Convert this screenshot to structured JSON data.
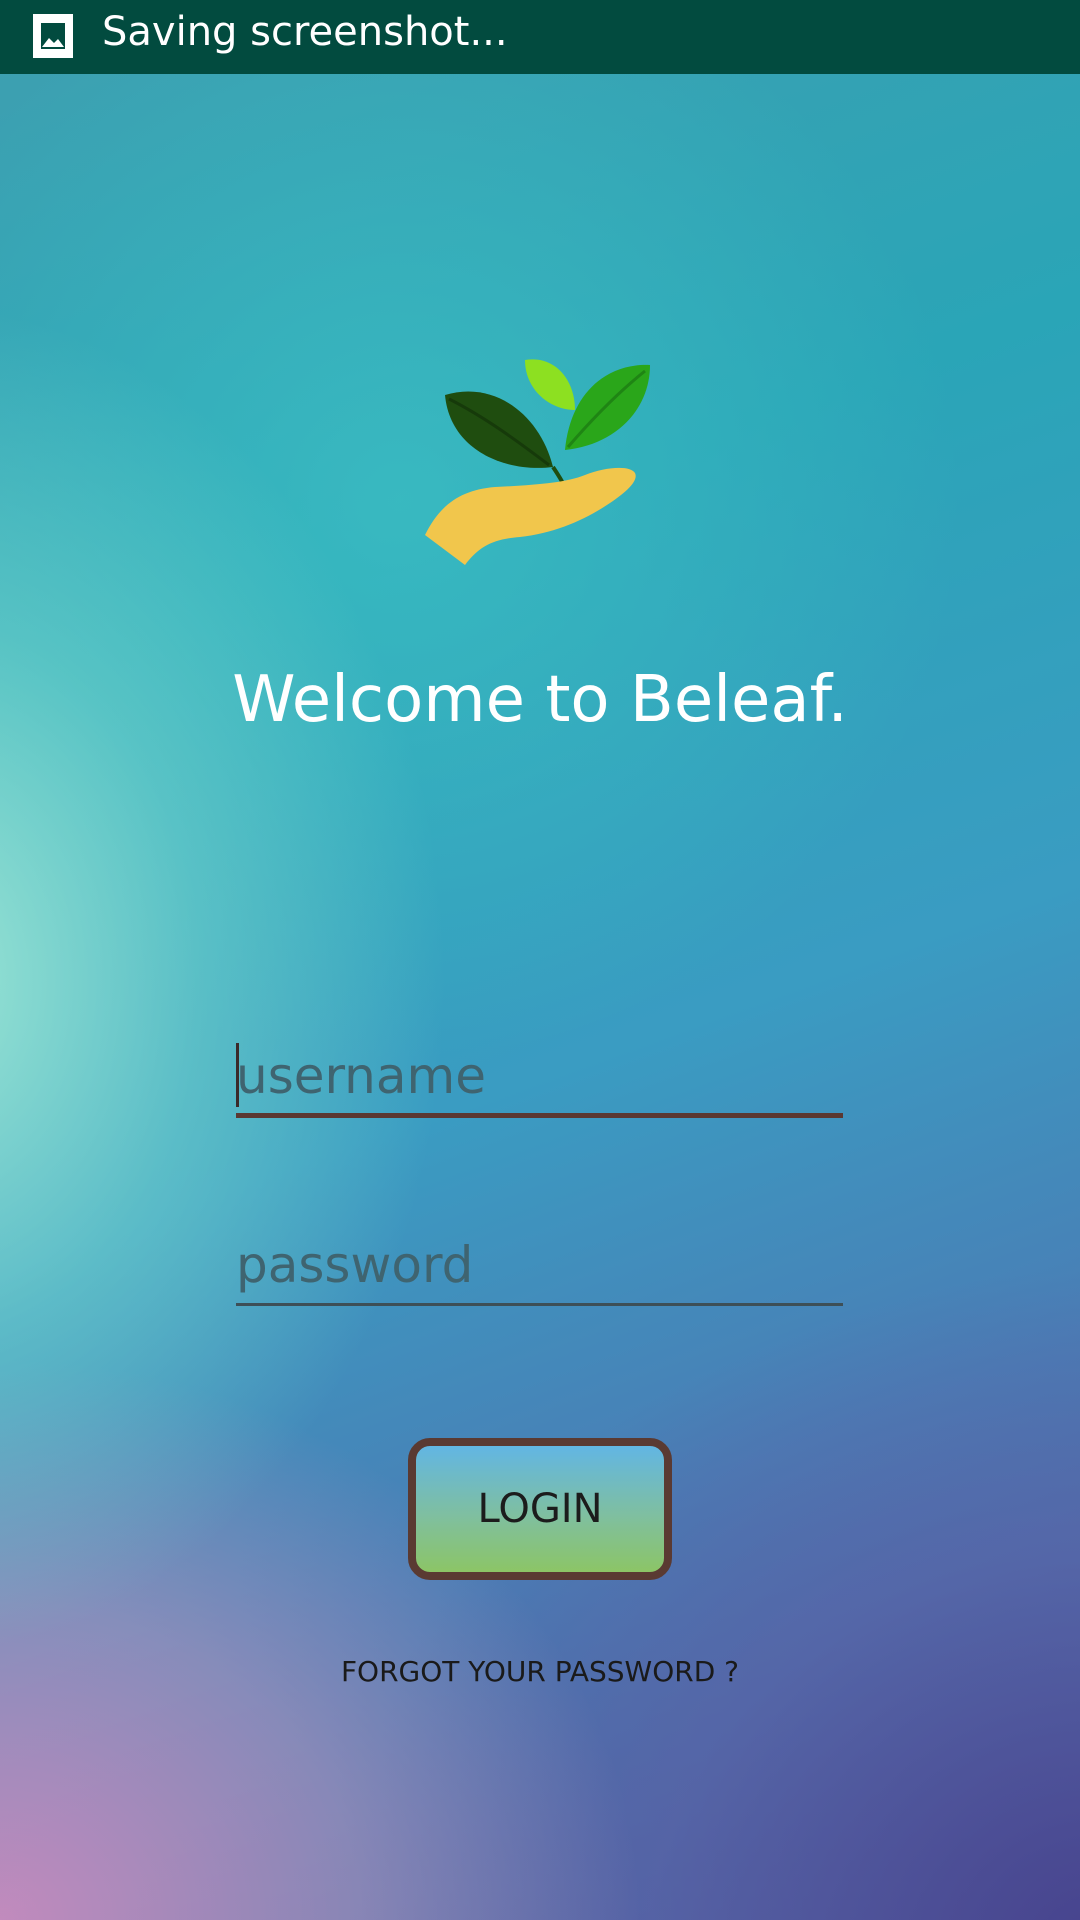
{
  "status_bar": {
    "icon": "image-icon",
    "text": "Saving screenshot..."
  },
  "logo": {
    "icon": "hand-with-leaves-icon"
  },
  "welcome_text": "Welcome to Beleaf.",
  "form": {
    "username": {
      "placeholder": "username",
      "value": ""
    },
    "password": {
      "placeholder": "password",
      "value": ""
    },
    "login_label": "LOGIN",
    "forgot_label": "FORGOT YOUR PASSWORD ?"
  },
  "colors": {
    "status_bar": "#024b3f",
    "login_border": "#5a3a32",
    "welcome_text": "#ffffff"
  }
}
